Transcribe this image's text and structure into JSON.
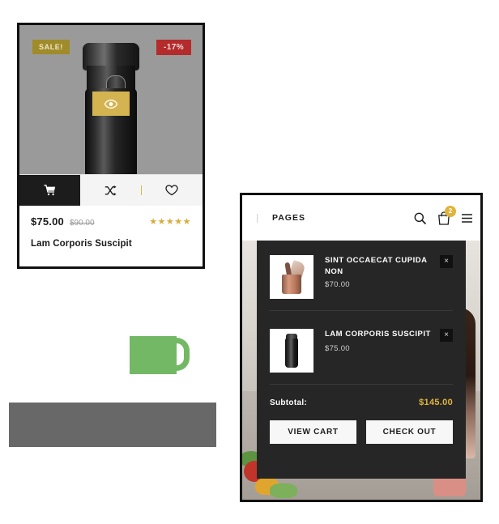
{
  "product_card": {
    "badges": {
      "sale": "SALE!",
      "discount": "-17%"
    },
    "quickview_icon": "eye-icon",
    "actions": {
      "add_to_cart": "cart-icon",
      "compare": "shuffle-icon",
      "wishlist": "heart-icon"
    },
    "price_current": "$75.00",
    "price_old": "$90.00",
    "rating_stars": "★★★★★",
    "title": "Lam Corporis Suscipit"
  },
  "cart_screen": {
    "header": {
      "nav_label": "PAGES",
      "search_icon": "search-icon",
      "cart_icon": "shopping-bag-icon",
      "cart_count": "2",
      "menu_icon": "hamburger-menu-icon"
    },
    "dropdown": {
      "items": [
        {
          "thumb": "copper-utensil-holder-thumbnail",
          "name": "SINT OCCAECAT CUPIDA NON",
          "price": "$70.00",
          "remove_label": "×"
        },
        {
          "thumb": "black-tumbler-thumbnail",
          "name": "LAM CORPORIS SUSCIPIT",
          "price": "$75.00",
          "remove_label": "×"
        }
      ],
      "subtotal_label": "Subtotal:",
      "subtotal_value": "$145.00",
      "view_cart_label": "VIEW CART",
      "checkout_label": "CHECK OUT"
    }
  },
  "colors": {
    "sale_badge": "#a08b2a",
    "discount_badge": "#b32b2b",
    "quickview": "#d4b451",
    "accent_gold": "#e0b43c",
    "panel_dark": "#262626",
    "green_block": "#73b864",
    "gray_block": "#686868"
  }
}
